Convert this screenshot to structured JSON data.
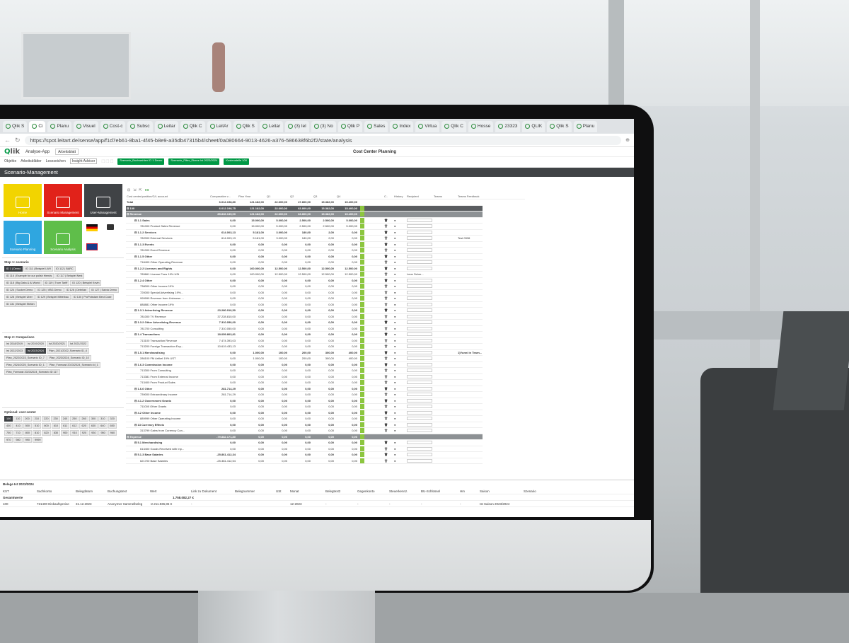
{
  "browser": {
    "tabs": [
      "Qlik S",
      "Ci",
      "Planu",
      "Visuel",
      "Cost-c",
      "Subsc",
      "Leitar",
      "Qlik C",
      "LeitAr",
      "Qlik S",
      "Leitar",
      "(3) Iel",
      "(3) No",
      "Qlik P",
      "Sales",
      "Index",
      "Virtua",
      "Qlik C",
      "Hosse",
      "23323",
      "QLIK",
      "Qlik S",
      "Planu"
    ],
    "url": "https://spot.leitart.de/sense/app/f1d7eb61-8ba1-4f45-b8e9-a35db47315b4/sheet/0a080664-9013-4626-a376-586638f6b2f2/state/analysis"
  },
  "app": {
    "logo_text": "Qlik",
    "app_name": "Analyse-App",
    "selector": "Arbeitsblatt",
    "center_title": "Cost Center Planning",
    "toolbar": [
      "Objekte",
      "Arbeitsblätter",
      "Lesezeichen",
      "Insight Advisor"
    ],
    "chips": [
      "Szenario_Buchwahlen ID 1 Demo",
      "Szenario_Filter_Ebene Ist 2023/2024",
      "Kostenstelle 100"
    ],
    "sheet_title": "Scenario-Management"
  },
  "left": {
    "tiles": [
      {
        "label": "Home",
        "color": "#f2d400"
      },
      {
        "label": "Scenario Management",
        "color": "#e1221a"
      },
      {
        "label": "User-Management",
        "color": "#404346"
      },
      {
        "label": "Scenario Planning",
        "color": "#2fa6e0"
      },
      {
        "label": "Scenario Analysis",
        "color": "#5fbe4a"
      }
    ],
    "step1_title": "Step 1: scenario",
    "step1": [
      "ID 1 | Demo",
      "ID 111 | Beispiel LWV",
      "ID 112 | BARC",
      "ID 116 | Example for our polish friends",
      "ID 117 | Beispiel Nest",
      "ID 118 | Big Data & AI World",
      "ID 119 | Trum Tariff",
      "ID 120 | Beispiel Kevin",
      "ID 124 | Sucker Demo",
      "ID 125 | VBG Demo",
      "ID 126 | Debrlian",
      "ID 127 | Salvia Demo",
      "ID 128 | Beispiel Uber",
      "ID 129 | Beispiel Mittelbau",
      "ID 130 | ProPotsdam Best Case",
      "ID 131 | Beispiel Stefan"
    ],
    "step2_title": "Step 2: Comparison",
    "step2": [
      "Ist 2018/2019",
      "Ist 2019/2020",
      "Ist 2020/2021",
      "Ist 2021/2022",
      "Ist 2022/2023",
      "Ist 2023/2024",
      "Plan_2021/2022_Scenario ID_4",
      "Plan_2022/2023_Scenario ID_7",
      "Plan_2023/2024_Scenario ID_10",
      "Plan_2024/2025_Scenario ID_1",
      "Plan_Forecast 2023/2024_Scenario Id_1",
      "Plan_Forecast 2023/2024_Scenario ID 117"
    ],
    "cc_title": "Optional: cost center",
    "cc": [
      "100",
      "110",
      "200",
      "210",
      "220",
      "230",
      "240",
      "250",
      "260",
      "300",
      "310",
      "320",
      "400",
      "410",
      "500",
      "510",
      "600",
      "610",
      "611",
      "612",
      "620",
      "630",
      "640",
      "650",
      "700",
      "710",
      "800",
      "810",
      "820",
      "830",
      "900",
      "910",
      "920",
      "930",
      "950",
      "960",
      "970",
      "980",
      "990",
      "9999"
    ]
  },
  "grid": {
    "headers": [
      "Cost center/position/G/L account",
      "Comparative v...",
      "Plan Year",
      "Q1",
      "Q2",
      "Q3",
      "Q4",
      "C..",
      "History",
      "Recipient",
      "Teams",
      "Teams Feedback"
    ],
    "rows": [
      {
        "t": "total",
        "label": "Total",
        "v": [
          "6.012.198,80",
          "121.182,00",
          "22.600,00",
          "47.800,00",
          "15.382,00",
          "15.400,00"
        ]
      },
      {
        "t": "dark",
        "label": "⊟ 100",
        "v": [
          "6.012.198,75",
          "121.182,00",
          "22.600,00",
          "63.800,00",
          "15.382,00",
          "15.400,00"
        ]
      },
      {
        "t": "grey",
        "label": "⊟ Revenue",
        "v": [
          "85.836.135,00",
          "121.182,00",
          "22.600,00",
          "63.800,00",
          "15.382,00",
          "15.400,00"
        ]
      },
      {
        "t": "b",
        "label": "⊟ 1.1 Sales",
        "v": [
          "0,00",
          "15.000,00",
          "5.000,00",
          "2.500,00",
          "2.500,00",
          "5.000,00"
        ]
      },
      {
        "t": "",
        "label": "781000 Product Sales Revenue",
        "v": [
          "0,00",
          "15.000,00",
          "5.000,00",
          "2.500,00",
          "2.500,00",
          "5.000,00"
        ]
      },
      {
        "t": "b",
        "label": "⊟ 1.1.2 Services",
        "v": [
          "614.003,13",
          "5.181,00",
          "3.000,00",
          "180,00",
          "2,00",
          "0,00"
        ]
      },
      {
        "t": "",
        "label": "782000 External Services",
        "v": [
          "614.003,13",
          "5.181,00",
          "3.000,00",
          "180,00",
          "2,00",
          "0,00"
        ]
      },
      {
        "t": "b",
        "label": "⊟ 1.1.3 Events",
        "v": [
          "0,00",
          "0,00",
          "0,00",
          "0,00",
          "0,00",
          "0,00"
        ]
      },
      {
        "t": "",
        "label": "781000 Event Revenue",
        "v": [
          "0,00",
          "0,00",
          "0,00",
          "0,00",
          "0,00",
          "0,00"
        ]
      },
      {
        "t": "b",
        "label": "⊟ 1.1.5 Other",
        "v": [
          "0,00",
          "0,00",
          "0,00",
          "0,00",
          "0,00",
          "0,00"
        ]
      },
      {
        "t": "",
        "label": "718400 Other Operating Revenue",
        "v": [
          "0,00",
          "0,00",
          "0,00",
          "0,00",
          "0,00",
          "0,00"
        ]
      },
      {
        "t": "b",
        "label": "⊟ 1.2.2 Licenses and Rights",
        "v": [
          "0,00",
          "100.000,00",
          "12.500,00",
          "12.500,00",
          "12.500,00",
          "12.500,00"
        ]
      },
      {
        "t": "",
        "label": "789661 License Fees 19% USt",
        "v": [
          "0,00",
          "100.000,00",
          "12.500,00",
          "12.500,00",
          "12.500,00",
          "12.500,00"
        ]
      },
      {
        "t": "b",
        "label": "⊟ 1.2.4 Other",
        "v": [
          "0,00",
          "0,00",
          "0,00",
          "0,00",
          "0,00",
          "0,00"
        ]
      },
      {
        "t": "",
        "label": "738000 Other Income 19%",
        "v": [
          "0,00",
          "0,00",
          "0,00",
          "0,00",
          "0,00",
          "0,00"
        ]
      },
      {
        "t": "",
        "label": "720000 Special Advertising 19%...",
        "v": [
          "0,00",
          "0,00",
          "0,00",
          "0,00",
          "0,00",
          "0,00"
        ]
      },
      {
        "t": "",
        "label": "999999 Revenue from Unknown ...",
        "v": [
          "0,00",
          "0,00",
          "0,00",
          "0,00",
          "0,00",
          "0,00"
        ]
      },
      {
        "t": "",
        "label": "888881 Other Income 19%",
        "v": [
          "0,00",
          "0,00",
          "0,00",
          "0,00",
          "0,00",
          "0,00"
        ]
      },
      {
        "t": "b",
        "label": "⊟ 1.3.1 Advertising Revenue",
        "v": [
          "23.280.910,50",
          "0,00",
          "0,00",
          "0,00",
          "0,00",
          "0,00"
        ]
      },
      {
        "t": "",
        "label": "781000 TV Revenue",
        "v": [
          "37.228.810,00",
          "0,00",
          "0,00",
          "0,00",
          "0,00",
          "0,00"
        ]
      },
      {
        "t": "b",
        "label": "⊟ 1.3.2 Other Advertising Revenue",
        "v": [
          "7.310.050,00",
          "0,00",
          "0,00",
          "0,00",
          "0,00",
          "0,00"
        ]
      },
      {
        "t": "",
        "label": "781700 Consulting",
        "v": [
          "7.310.050,00",
          "0,00",
          "0,00",
          "0,00",
          "0,00",
          "0,00"
        ]
      },
      {
        "t": "b",
        "label": "⊟ 1.4 Transactions",
        "v": [
          "18.059.803,81",
          "0,00",
          "0,00",
          "0,00",
          "0,00",
          "0,00"
        ]
      },
      {
        "t": "",
        "label": "713100 Transaction Revenue",
        "v": [
          "7.474.393,03",
          "0,00",
          "0,00",
          "0,00",
          "0,00",
          "0,00"
        ]
      },
      {
        "t": "",
        "label": "713200 Foreign Transaction Exp...",
        "v": [
          "10.619.433,13",
          "0,00",
          "0,00",
          "0,00",
          "0,00",
          "0,00"
        ]
      },
      {
        "t": "b",
        "label": "⊟ 1.5.1 Merchandising",
        "v": [
          "0,00",
          "1.000,00",
          "100,00",
          "200,00",
          "300,00",
          "400,00"
        ]
      },
      {
        "t": "",
        "label": "286100 FM Artikel 19% UST",
        "v": [
          "0,00",
          "1.000,00",
          "100,00",
          "200,00",
          "300,00",
          "400,00"
        ]
      },
      {
        "t": "b",
        "label": "⊟ 1.6.3 Commission Income",
        "v": [
          "0,00",
          "0,00",
          "0,00",
          "0,00",
          "0,00",
          "0,00"
        ]
      },
      {
        "t": "",
        "label": "713300 From Consulting",
        "v": [
          "0,00",
          "0,00",
          "0,00",
          "0,00",
          "0,00",
          "0,00"
        ]
      },
      {
        "t": "",
        "label": "713381 From External Income",
        "v": [
          "0,00",
          "0,00",
          "0,00",
          "0,00",
          "0,00",
          "0,00"
        ]
      },
      {
        "t": "",
        "label": "713400 From Product Sales",
        "v": [
          "0,00",
          "0,00",
          "0,00",
          "0,00",
          "0,00",
          "0,00"
        ]
      },
      {
        "t": "b",
        "label": "⊟ 1.6.6 Other",
        "v": [
          "281.714,29",
          "0,00",
          "0,00",
          "0,00",
          "0,00",
          "0,00"
        ]
      },
      {
        "t": "",
        "label": "739000 Extraordinary Income",
        "v": [
          "281.714,29",
          "0,00",
          "0,00",
          "0,00",
          "0,00",
          "0,00"
        ]
      },
      {
        "t": "b",
        "label": "⊟ 4.1.2 Government Grants",
        "v": [
          "0,00",
          "0,00",
          "0,00",
          "0,00",
          "0,00",
          "0,00"
        ]
      },
      {
        "t": "",
        "label": "711000 Other Grants",
        "v": [
          "0,00",
          "0,00",
          "0,00",
          "0,00",
          "0,00",
          "0,00"
        ]
      },
      {
        "t": "b",
        "label": "⊟ 4.2 Other Income",
        "v": [
          "0,00",
          "0,00",
          "0,00",
          "0,00",
          "0,00",
          "0,00"
        ]
      },
      {
        "t": "",
        "label": "889999 Other Operating Income",
        "v": [
          "0,00",
          "0,00",
          "0,00",
          "0,00",
          "0,00",
          "0,00"
        ]
      },
      {
        "t": "b",
        "label": "⊟ 13 Currency Effects",
        "v": [
          "0,00",
          "0,00",
          "0,00",
          "0,00",
          "0,00",
          "0,00"
        ]
      },
      {
        "t": "",
        "label": "313799 Gains from Currency Con...",
        "v": [
          "0,00",
          "0,00",
          "0,00",
          "0,00",
          "0,00",
          "0,00"
        ]
      },
      {
        "t": "grey",
        "label": "⊟ Expense",
        "v": [
          "-79.882.171,80",
          "0,00",
          "0,00",
          "0,00",
          "0,00",
          "0,00"
        ]
      },
      {
        "t": "b",
        "label": "⊟ 5.1 Merchandising",
        "v": [
          "0,00",
          "0,00",
          "0,00",
          "0,00",
          "0,00",
          "0,00"
        ]
      },
      {
        "t": "",
        "label": "613400 Goods Received with Inp...",
        "v": [
          "0,00",
          "0,00",
          "0,00",
          "0,00",
          "0,00",
          "0,00"
        ]
      },
      {
        "t": "b",
        "label": "⊟ 5.1.3 Base Salaries",
        "v": [
          "-25.861.412,34",
          "0,00",
          "0,00",
          "0,00",
          "0,00",
          "0,00"
        ]
      },
      {
        "t": "",
        "label": "621700 Base Salaries",
        "v": [
          "-25.381.412,54",
          "0,00",
          "0,00",
          "0,00",
          "0,00",
          "0,00"
        ]
      }
    ],
    "notes": {
      "6": "Test 0336",
      "12": "Leon Schm...",
      "25": "1)Yunni in Tearn..."
    }
  },
  "bottom": {
    "title": "Belege Ist 2023/2024",
    "headers": [
      "KST",
      "Sachkonto",
      "Belegdatum",
      "Buchungstext",
      "Wert",
      "Link zu Dokument",
      "Belegnummer",
      "USt",
      "Monat",
      "Belegtext2",
      "Gegenkonto",
      "Steuerkennz.",
      "BU-Schlüssel",
      "Hm",
      "Saison",
      "Szenario"
    ],
    "sum_label": "Gesamtwerte",
    "sum_value": "1.758.082,27 €",
    "row": [
      "100",
      "721400 Einkaufspreise",
      "31.12.2023",
      "Anonymer Sammelbeleg",
      "-2.211.836,86 €",
      "-",
      "",
      "",
      "12-2023",
      "-",
      "-",
      "-",
      "-",
      "-",
      "Ist Saison 2023/2024"
    ]
  }
}
